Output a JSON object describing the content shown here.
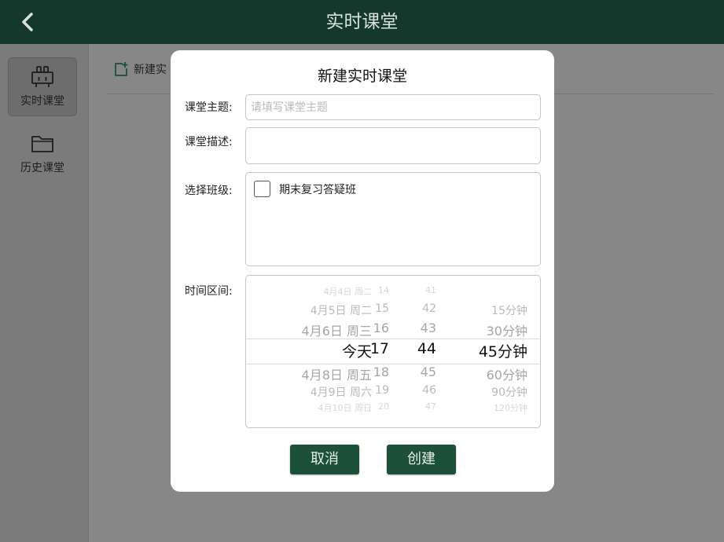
{
  "header": {
    "title": "实时课堂",
    "back_icon": "chevron-left-icon"
  },
  "sidebar": {
    "items": [
      {
        "label": "实时课堂",
        "icon": "classroom-icon",
        "active": true
      },
      {
        "label": "历史课堂",
        "icon": "folder-icon",
        "active": false
      }
    ]
  },
  "content": {
    "new_button_label": "新建实",
    "new_button_icon": "add-square-icon"
  },
  "dialog": {
    "title": "新建实时课堂",
    "topic": {
      "label": "课堂主题:",
      "placeholder": "请填写课堂主题",
      "value": ""
    },
    "description": {
      "label": "课堂描述:",
      "value": ""
    },
    "classes": {
      "label": "选择班级:",
      "items": [
        {
          "name": "期末复习答疑班",
          "checked": false
        }
      ]
    },
    "time_range": {
      "label": "时间区间:",
      "date_column": [
        "4月4日 周二",
        "4月5日 周二",
        "4月6日 周三",
        "今天",
        "4月8日 周五",
        "4月9日 周六",
        "4月10日 周日"
      ],
      "hour_column": [
        "14",
        "15",
        "16",
        "17",
        "18",
        "19",
        "20"
      ],
      "minute_column": [
        "41",
        "42",
        "43",
        "44",
        "45",
        "46",
        "47"
      ],
      "duration_column": [
        "",
        "15分钟",
        "30分钟",
        "45分钟",
        "60分钟",
        "90分钟",
        "120分钟"
      ],
      "selected": {
        "date": "今天",
        "hour": "17",
        "minute": "44",
        "duration": "45分钟"
      }
    },
    "cancel_label": "取消",
    "create_label": "创建"
  },
  "colors": {
    "header_bg": "#14392c",
    "button_bg": "#1c5038",
    "overlay": "#8a8a8a"
  }
}
